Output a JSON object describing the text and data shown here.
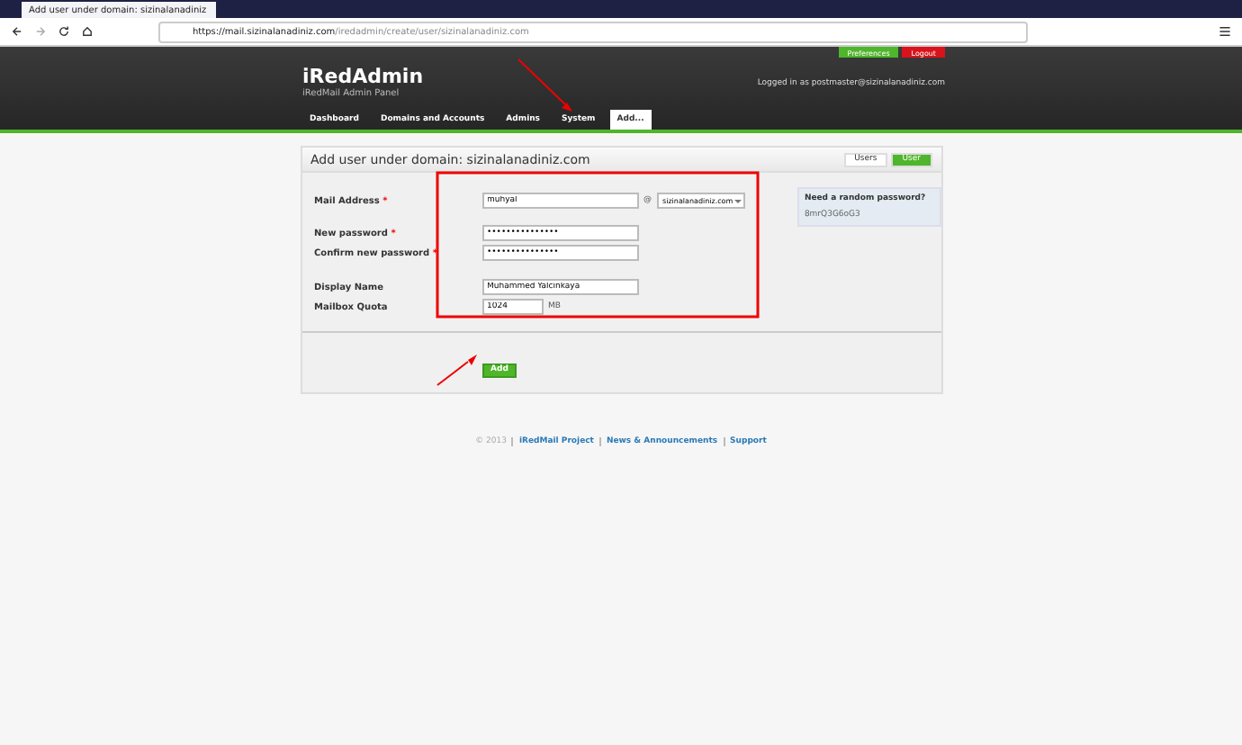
{
  "browser": {
    "tab_title": "Add user under domain: sizinalanadiniz",
    "url_host": "https://mail.sizinalanadiniz.com",
    "url_path": "/iredadmin/create/user/sizinalanadiniz.com"
  },
  "header": {
    "title": "iRedAdmin",
    "subtitle": "iRedMail Admin Panel",
    "preferences": "Preferences",
    "logout": "Logout",
    "logged_in": "Logged in as postmaster@sizinalanadiniz.com"
  },
  "nav": [
    {
      "label": "Dashboard",
      "selected": false
    },
    {
      "label": "Domains and Accounts",
      "selected": false
    },
    {
      "label": "Admins",
      "selected": false
    },
    {
      "label": "System",
      "selected": false
    },
    {
      "label": "Add...",
      "selected": true
    }
  ],
  "panel": {
    "title": "Add user under domain: sizinalanadiniz.com",
    "tabs": [
      {
        "label": "Users",
        "selected": false
      },
      {
        "label": "User",
        "selected": true
      }
    ]
  },
  "form": [
    {
      "kind": "email",
      "label": "Mail Address",
      "required": "*",
      "value": "muhyal",
      "at": "@",
      "domain": "sizinalanadiniz.com"
    },
    {
      "kind": "text",
      "label": "New password",
      "required": "*",
      "value": "•••••••••••••••"
    },
    {
      "kind": "text",
      "label": "Confirm new password",
      "required": "*",
      "value": "•••••••••••••••"
    },
    {
      "kind": "text",
      "label": "Display Name",
      "value": "Muhammed Yalcinkaya"
    },
    {
      "kind": "quota",
      "label": "Mailbox Quota",
      "value": "1024",
      "unit": "MB"
    }
  ],
  "random_password": {
    "title": "Need a random password?",
    "value": "8mrQ3G6oG3"
  },
  "submit": "Add",
  "footer": [
    {
      "kind": "text",
      "label": "© 2013"
    },
    {
      "kind": "link",
      "label": "iRedMail Project"
    },
    {
      "kind": "link",
      "label": "News & Announcements"
    },
    {
      "kind": "link",
      "label": "Support"
    }
  ]
}
